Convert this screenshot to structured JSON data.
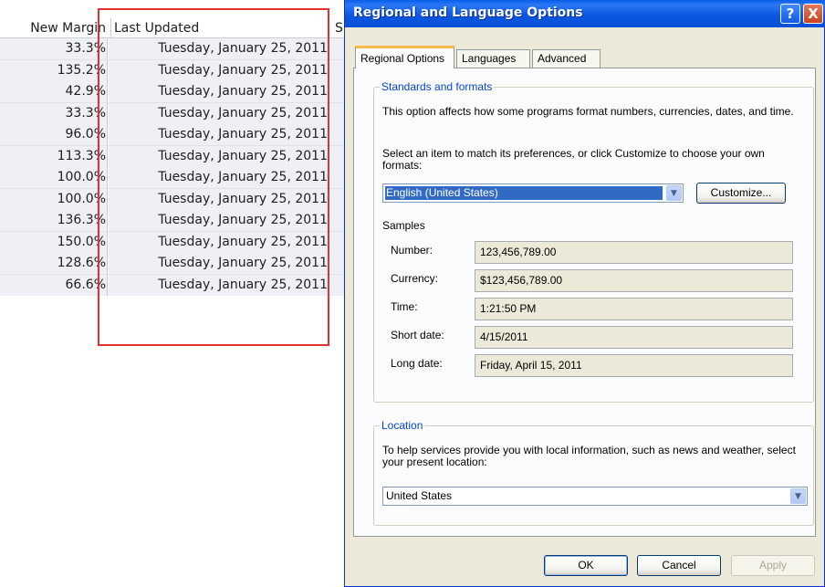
{
  "spreadsheet": {
    "columns": [
      "New Margin",
      "Last Updated",
      "S"
    ],
    "rows": [
      {
        "margin": "33.3%",
        "updated": "Tuesday, January 25, 2011"
      },
      {
        "margin": "135.2%",
        "updated": "Tuesday, January 25, 2011"
      },
      {
        "margin": "42.9%",
        "updated": "Tuesday, January 25, 2011"
      },
      {
        "margin": "33.3%",
        "updated": "Tuesday, January 25, 2011"
      },
      {
        "margin": "96.0%",
        "updated": "Tuesday, January 25, 2011"
      },
      {
        "margin": "113.3%",
        "updated": "Tuesday, January 25, 2011"
      },
      {
        "margin": "100.0%",
        "updated": "Tuesday, January 25, 2011"
      },
      {
        "margin": "100.0%",
        "updated": "Tuesday, January 25, 2011"
      },
      {
        "margin": "136.3%",
        "updated": "Tuesday, January 25, 2011"
      },
      {
        "margin": "150.0%",
        "updated": "Tuesday, January 25, 2011"
      },
      {
        "margin": "128.6%",
        "updated": "Tuesday, January 25, 2011"
      },
      {
        "margin": "66.6%",
        "updated": "Tuesday, January 25, 2011"
      }
    ],
    "highlight_color": "#e23131"
  },
  "dialog": {
    "title": "Regional and Language Options",
    "help_glyph": "?",
    "close_glyph": "X",
    "tabs": [
      {
        "label": "Regional Options",
        "active": true
      },
      {
        "label": "Languages",
        "active": false
      },
      {
        "label": "Advanced",
        "active": false
      }
    ],
    "standards": {
      "title": "Standards and formats",
      "description": "This option affects how some programs format numbers, currencies, dates, and time.",
      "instruction": "Select an item to match its preferences, or click Customize to choose your own formats:",
      "selected_format": "English (United States)",
      "customize_label": "Customize...",
      "samples_label": "Samples",
      "samples": [
        {
          "label": "Number:",
          "value": "123,456,789.00"
        },
        {
          "label": "Currency:",
          "value": "$123,456,789.00"
        },
        {
          "label": "Time:",
          "value": "1:21:50 PM"
        },
        {
          "label": "Short date:",
          "value": "4/15/2011"
        },
        {
          "label": "Long date:",
          "value": "Friday, April 15, 2011"
        }
      ]
    },
    "location": {
      "title": "Location",
      "description": "To help services provide you with local information, such as news and weather, select your present location:",
      "selected": "United States"
    },
    "buttons": {
      "ok": "OK",
      "cancel": "Cancel",
      "apply": "Apply"
    },
    "colors": {
      "titlebar": "#0b58e2",
      "face": "#ece9d8",
      "group_title": "#0046d5",
      "selection": "#316ac5"
    }
  }
}
